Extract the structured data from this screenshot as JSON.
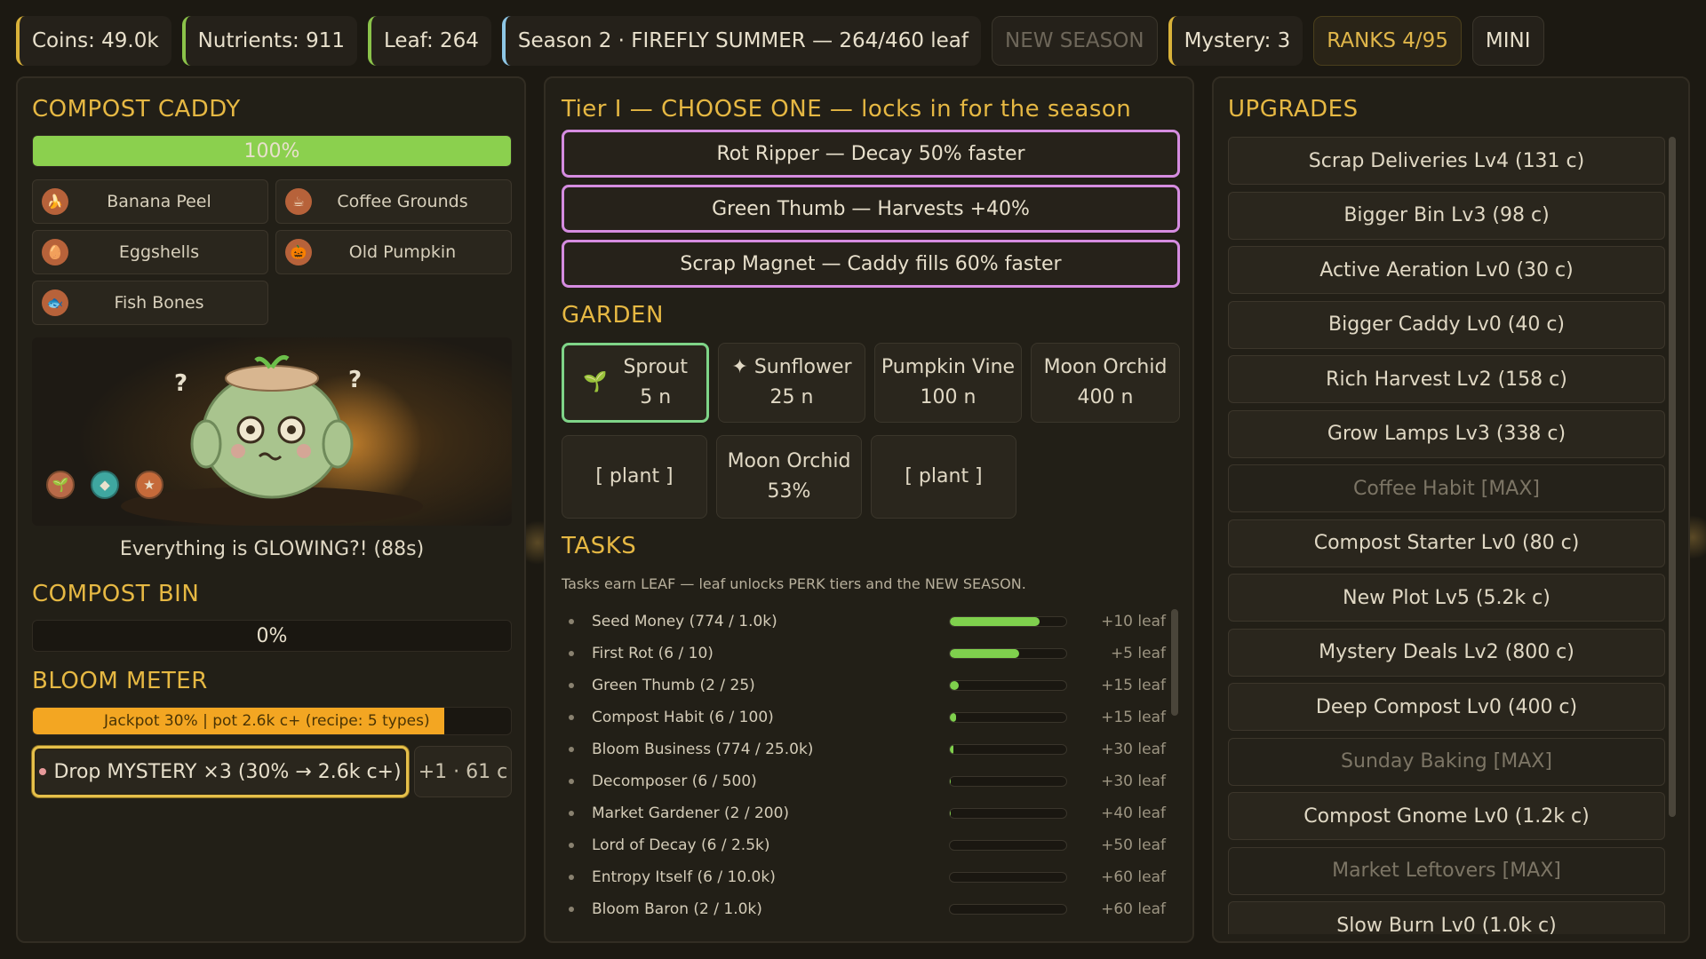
{
  "topbar": {
    "coins": "Coins: 49.0k",
    "nutrients": "Nutrients: 911",
    "leaf": "Leaf: 264",
    "season": "Season 2 · FIREFLY SUMMER — 264/460 leaf",
    "new_season": "NEW SEASON",
    "mystery": "Mystery: 3",
    "ranks": "RANKS  4/95",
    "mini": "MINI"
  },
  "caddy": {
    "title": "COMPOST CADDY",
    "progress_label": "100%",
    "progress": 1.0,
    "scraps": [
      {
        "label": "Banana Peel",
        "icon": "banana-icon",
        "glyph": "🍌"
      },
      {
        "label": "Coffee Grounds",
        "icon": "coffee-icon",
        "glyph": "☕"
      },
      {
        "label": "Eggshells",
        "icon": "egg-icon",
        "glyph": "🥚"
      },
      {
        "label": "Old Pumpkin",
        "icon": "pumpkin-icon",
        "glyph": "🎃"
      },
      {
        "label": "Fish Bones",
        "icon": "fish-icon",
        "glyph": "🐟"
      }
    ]
  },
  "scene": {
    "status": "Everything is GLOWING?! (88s)",
    "badges": [
      "seedling-badge-icon",
      "gem-badge-icon",
      "star-badge-icon"
    ]
  },
  "bin": {
    "title": "COMPOST BIN",
    "progress_label": "0%",
    "progress": 0.0
  },
  "bloom": {
    "title": "BLOOM METER",
    "meter_label": "Jackpot 30%  |  pot 2.6k c+  (recipe: 5 types)",
    "meter": 0.86,
    "drop_button": "Drop MYSTERY ×3  (30% → 2.6k c+)",
    "side_button": "+1 · 61 c"
  },
  "perks": {
    "title": "Tier I — CHOOSE ONE — locks in for the season",
    "options": [
      "Rot Ripper — Decay 50% faster",
      "Green Thumb — Harvests +40%",
      "Scrap Magnet — Caddy fills 60% faster"
    ]
  },
  "garden": {
    "title": "GARDEN",
    "seeds": [
      {
        "name": "Sprout",
        "cost": "5 n",
        "selected": true
      },
      {
        "name": "✦ Sunflower",
        "cost": "25 n"
      },
      {
        "name": "Pumpkin Vine",
        "cost": "100 n"
      },
      {
        "name": "Moon Orchid",
        "cost": "400 n"
      }
    ],
    "plots": [
      {
        "line1": "[ plant ]",
        "line2": ""
      },
      {
        "line1": "Moon Orchid",
        "line2": "53%"
      },
      {
        "line1": "[ plant ]",
        "line2": ""
      }
    ]
  },
  "tasks": {
    "title": "TASKS",
    "note": "Tasks earn LEAF — leaf unlocks PERK tiers and the NEW SEASON.",
    "items": [
      {
        "name": "Seed Money  (774 / 1.0k)",
        "progress": 0.774,
        "reward": "+10 leaf"
      },
      {
        "name": "First Rot  (6 / 10)",
        "progress": 0.6,
        "reward": "+5 leaf"
      },
      {
        "name": "Green Thumb  (2 / 25)",
        "progress": 0.08,
        "reward": "+15 leaf"
      },
      {
        "name": "Compost Habit  (6 / 100)",
        "progress": 0.06,
        "reward": "+15 leaf"
      },
      {
        "name": "Bloom Business  (774 / 25.0k)",
        "progress": 0.031,
        "reward": "+30 leaf"
      },
      {
        "name": "Decomposer  (6 / 500)",
        "progress": 0.012,
        "reward": "+30 leaf"
      },
      {
        "name": "Market Gardener  (2 / 200)",
        "progress": 0.01,
        "reward": "+40 leaf"
      },
      {
        "name": "Lord of Decay  (6 / 2.5k)",
        "progress": 0.0024,
        "reward": "+50 leaf"
      },
      {
        "name": "Entropy Itself  (6 / 10.0k)",
        "progress": 0.0006,
        "reward": "+60 leaf"
      },
      {
        "name": "Bloom Baron  (2 / 1.0k)",
        "progress": 0.002,
        "reward": "+60 leaf"
      }
    ]
  },
  "upgrades": {
    "title": "UPGRADES",
    "items": [
      {
        "label": "Scrap Deliveries  Lv4  (131 c)",
        "max": false
      },
      {
        "label": "Bigger Bin  Lv3  (98 c)",
        "max": false
      },
      {
        "label": "Active Aeration  Lv0  (30 c)",
        "max": false
      },
      {
        "label": "Bigger Caddy  Lv0  (40 c)",
        "max": false
      },
      {
        "label": "Rich Harvest  Lv2  (158 c)",
        "max": false
      },
      {
        "label": "Grow Lamps  Lv3  (338 c)",
        "max": false
      },
      {
        "label": "Coffee Habit [MAX]",
        "max": true
      },
      {
        "label": "Compost Starter  Lv0  (80 c)",
        "max": false
      },
      {
        "label": "New Plot  Lv5  (5.2k c)",
        "max": false
      },
      {
        "label": "Mystery Deals  Lv2  (800 c)",
        "max": false
      },
      {
        "label": "Deep Compost  Lv0  (400 c)",
        "max": false
      },
      {
        "label": "Sunday Baking [MAX]",
        "max": true
      },
      {
        "label": "Compost Gnome  Lv0  (1.2k c)",
        "max": false
      },
      {
        "label": "Market Leftovers [MAX]",
        "max": true
      },
      {
        "label": "Slow Burn  Lv0  (1.0k c)",
        "max": false
      }
    ]
  },
  "colors": {
    "accent": "#e6b843",
    "caddy_fill": "#8bd04e",
    "bloom_fill": "#f3a622",
    "perk_border": "#d58ce0",
    "selected_plot": "#7fd488"
  }
}
